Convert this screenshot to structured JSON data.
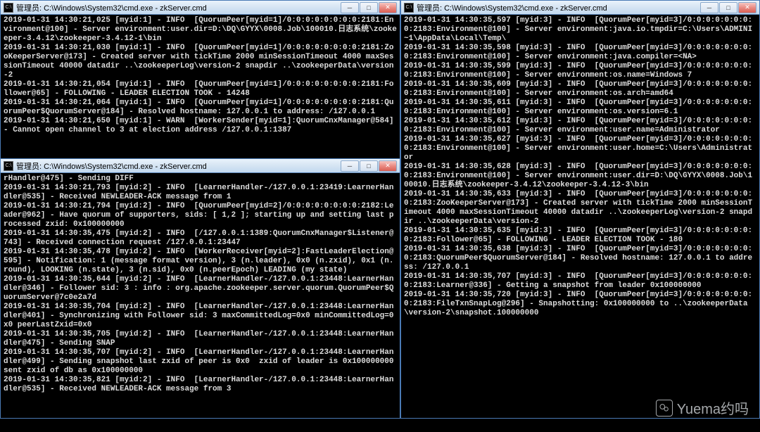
{
  "windows": {
    "win1": {
      "title": "管理员: C:\\Windows\\System32\\cmd.exe - zkServer.cmd",
      "body": "2019-01-31 14:30:21,025 [myid:1] - INFO  [QuorumPeer[myid=1]/0:0:0:0:0:0:0:0:2181:Environment@100] - Server environment:user.dir=D:\\DQ\\GYYX\\0008.Job\\100010.日志系统\\zookeeper-3.4.12\\zookeeper-3.4.12-1\\bin\n2019-01-31 14:30:21,030 [myid:1] - INFO  [QuorumPeer[myid=1]/0:0:0:0:0:0:0:0:2181:ZooKeeperServer@173] - Created server with tickTime 2000 minSessionTimeout 4000 maxSessionTimeout 40000 datadir ..\\zookeeperLog\\version-2 snapdir ..\\zookeeperData\\version-2\n2019-01-31 14:30:21,054 [myid:1] - INFO  [QuorumPeer[myid=1]/0:0:0:0:0:0:0:0:2181:Follower@65] - FOLLOWING - LEADER ELECTION TOOK - 14248\n2019-01-31 14:30:21,064 [myid:1] - INFO  [QuorumPeer[myid=1]/0:0:0:0:0:0:0:0:2181:QuorumPeer$QuorumServer@184] - Resolved hostname: 127.0.0.1 to address: /127.0.0.1\n2019-01-31 14:30:21,650 [myid:1] - WARN  [WorkerSender[myid=1]:QuorumCnxManager@584] - Cannot open channel to 3 at election address /127.0.0.1:1387"
    },
    "win2": {
      "title": "管理员: C:\\Windows\\System32\\cmd.exe - zkServer.cmd",
      "body": "rHandler@475] - Sending DIFF\n2019-01-31 14:30:21,793 [myid:2] - INFO  [LearnerHandler-/127.0.0.1:23419:LearnerHandler@535] - Received NEWLEADER-ACK message from 1\n2019-01-31 14:30:21,794 [myid:2] - INFO  [QuorumPeer[myid=2]/0:0:0:0:0:0:0:0:2182:Leader@962] - Have quorum of supporters, sids: [ 1,2 ]; starting up and setting last processed zxid: 0x100000000\n2019-01-31 14:30:35,475 [myid:2] - INFO  [/127.0.0.1:1389:QuorumCnxManager$Listener@743] - Received connection request /127.0.0.1:23447\n2019-01-31 14:30:35,478 [myid:2] - INFO  [WorkerReceiver[myid=2]:FastLeaderElection@595] - Notification: 1 (message format version), 3 (n.leader), 0x0 (n.zxid), 0x1 (n.round), LOOKING (n.state), 3 (n.sid), 0x0 (n.peerEpoch) LEADING (my state)\n2019-01-31 14:30:35,644 [myid:2] - INFO  [LearnerHandler-/127.0.0.1:23448:LearnerHandler@346] - Follower sid: 3 : info : org.apache.zookeeper.server.quorum.QuorumPeer$QuorumServer@7c0e2a7d\n2019-01-31 14:30:35,704 [myid:2] - INFO  [LearnerHandler-/127.0.0.1:23448:LearnerHandler@401] - Synchronizing with Follower sid: 3 maxCommittedLog=0x0 minCommittedLog=0x0 peerLastZxid=0x0\n2019-01-31 14:30:35,705 [myid:2] - INFO  [LearnerHandler-/127.0.0.1:23448:LearnerHandler@475] - Sending SNAP\n2019-01-31 14:30:35,707 [myid:2] - INFO  [LearnerHandler-/127.0.0.1:23448:LearnerHandler@499] - Sending snapshot last zxid of peer is 0x0  zxid of leader is 0x100000000sent zxid of db as 0x100000000\n2019-01-31 14:30:35,821 [myid:2] - INFO  [LearnerHandler-/127.0.0.1:23448:LearnerHandler@535] - Received NEWLEADER-ACK message from 3"
    },
    "win3": {
      "title": "管理员: C:\\Windows\\System32\\cmd.exe - zkServer.cmd",
      "body": "2019-01-31 14:30:35,597 [myid:3] - INFO  [QuorumPeer[myid=3]/0:0:0:0:0:0:0:0:2183:Environment@100] - Server environment:java.io.tmpdir=C:\\Users\\ADMINI~1\\AppData\\Local\\Temp\\\n2019-01-31 14:30:35,598 [myid:3] - INFO  [QuorumPeer[myid=3]/0:0:0:0:0:0:0:0:2183:Environment@100] - Server environment:java.compiler=<NA>\n2019-01-31 14:30:35,599 [myid:3] - INFO  [QuorumPeer[myid=3]/0:0:0:0:0:0:0:0:2183:Environment@100] - Server environment:os.name=Windows 7\n2019-01-31 14:30:35,609 [myid:3] - INFO  [QuorumPeer[myid=3]/0:0:0:0:0:0:0:0:2183:Environment@100] - Server environment:os.arch=amd64\n2019-01-31 14:30:35,611 [myid:3] - INFO  [QuorumPeer[myid=3]/0:0:0:0:0:0:0:0:2183:Environment@100] - Server environment:os.version=6.1\n2019-01-31 14:30:35,612 [myid:3] - INFO  [QuorumPeer[myid=3]/0:0:0:0:0:0:0:0:2183:Environment@100] - Server environment:user.name=Administrator\n2019-01-31 14:30:35,627 [myid:3] - INFO  [QuorumPeer[myid=3]/0:0:0:0:0:0:0:0:2183:Environment@100] - Server environment:user.home=C:\\Users\\Administrator\n2019-01-31 14:30:35,628 [myid:3] - INFO  [QuorumPeer[myid=3]/0:0:0:0:0:0:0:0:2183:Environment@100] - Server environment:user.dir=D:\\DQ\\GYYX\\0008.Job\\100010.日志系统\\zookeeper-3.4.12\\zookeeper-3.4.12-3\\bin\n2019-01-31 14:30:35,633 [myid:3] - INFO  [QuorumPeer[myid=3]/0:0:0:0:0:0:0:0:2183:ZooKeeperServer@173] - Created server with tickTime 2000 minSessionTimeout 4000 maxSessionTimeout 40000 datadir ..\\zookeeperLog\\version-2 snapdir ..\\zookeeperData\\version-2\n2019-01-31 14:30:35,635 [myid:3] - INFO  [QuorumPeer[myid=3]/0:0:0:0:0:0:0:0:2183:Follower@65] - FOLLOWING - LEADER ELECTION TOOK - 180\n2019-01-31 14:30:35,638 [myid:3] - INFO  [QuorumPeer[myid=3]/0:0:0:0:0:0:0:0:2183:QuorumPeer$QuorumServer@184] - Resolved hostname: 127.0.0.1 to address: /127.0.0.1\n2019-01-31 14:30:35,707 [myid:3] - INFO  [QuorumPeer[myid=3]/0:0:0:0:0:0:0:0:2183:Learner@336] - Getting a snapshot from leader 0x100000000\n2019-01-31 14:30:35,720 [myid:3] - INFO  [QuorumPeer[myid=3]/0:0:0:0:0:0:0:0:2183:FileTxnSnapLog@296] - Snapshotting: 0x100000000 to ..\\zookeeperData\\version-2\\snapshot.100000000"
    }
  },
  "watermark": {
    "text": "Yuema约吗"
  },
  "win_controls": {
    "minimize": "─",
    "maximize": "□",
    "close": "✕"
  },
  "cmd_icon_glyph": "C:\\"
}
